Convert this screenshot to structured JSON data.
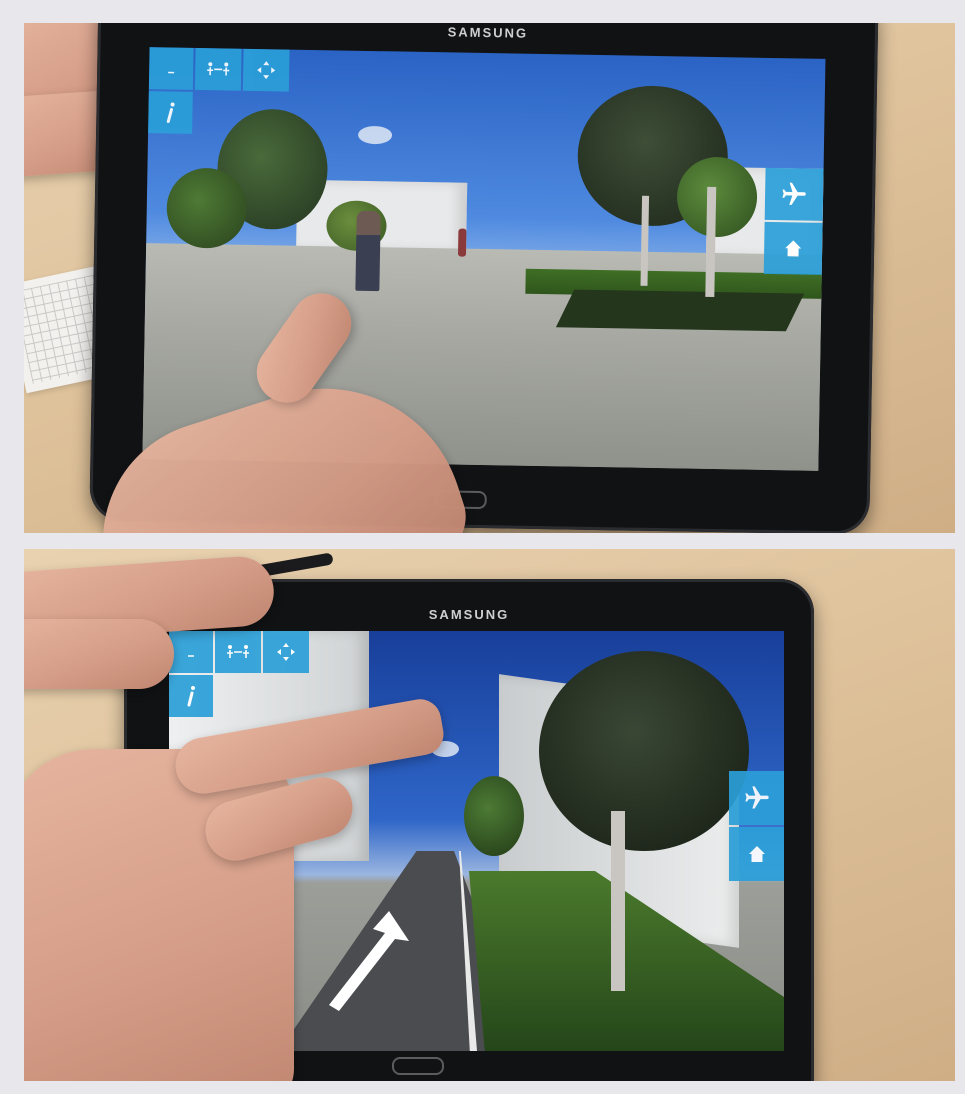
{
  "photos": [
    {
      "device_brand": "SAMSUNG",
      "scene": "pedestrian-plaza",
      "toolbar_icons": [
        "pedestrians-icon",
        "move-arrows-icon",
        "info-icon"
      ],
      "side_icons": [
        "airplane-icon",
        "home-icon"
      ]
    },
    {
      "device_brand": "SAMSUNG",
      "scene": "street-with-arrow",
      "toolbar_icons": [
        "pedestrians-icon",
        "move-arrows-icon",
        "info-icon"
      ],
      "side_icons": [
        "airplane-icon",
        "home-icon"
      ]
    }
  ],
  "colors": {
    "ui_accent": "#2b9fd8",
    "tablet_bezel": "#111214",
    "sky": "#2a63c4",
    "grass": "#3f6e25"
  }
}
